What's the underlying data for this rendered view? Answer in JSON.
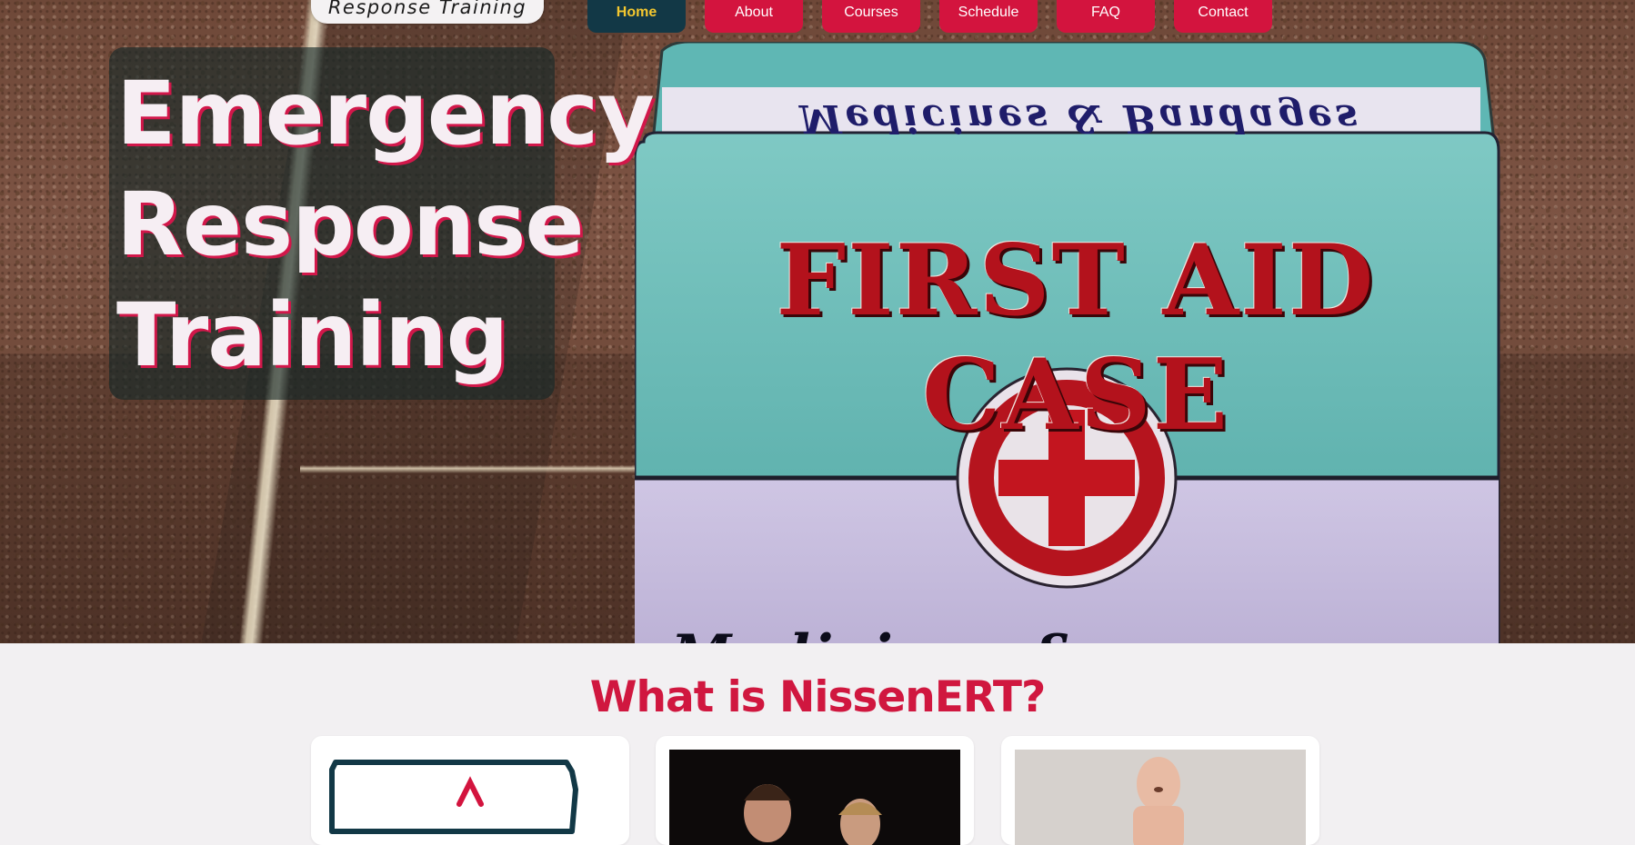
{
  "site": {
    "logo_text": "Response Training"
  },
  "nav": {
    "items": [
      {
        "label": "Home",
        "active": true
      },
      {
        "label": "About",
        "active": false
      },
      {
        "label": "Courses",
        "active": false
      },
      {
        "label": "Schedule",
        "active": false
      },
      {
        "label": "FAQ",
        "active": false
      },
      {
        "label": "Contact",
        "active": false
      }
    ]
  },
  "hero": {
    "title_lines": [
      "Emergency",
      "Response",
      "Training"
    ],
    "image_text": {
      "case_label": "FIRST AID CASE",
      "top_band": "Medicines & Bandages",
      "bottom_band": "Medicines & Bandages"
    }
  },
  "section": {
    "title": "What is NissenERT?"
  },
  "colors": {
    "accent": "#d3143e",
    "nav_active_bg": "#123846",
    "nav_active_text": "#f3c72f",
    "page_bg": "#f2f0f2"
  }
}
